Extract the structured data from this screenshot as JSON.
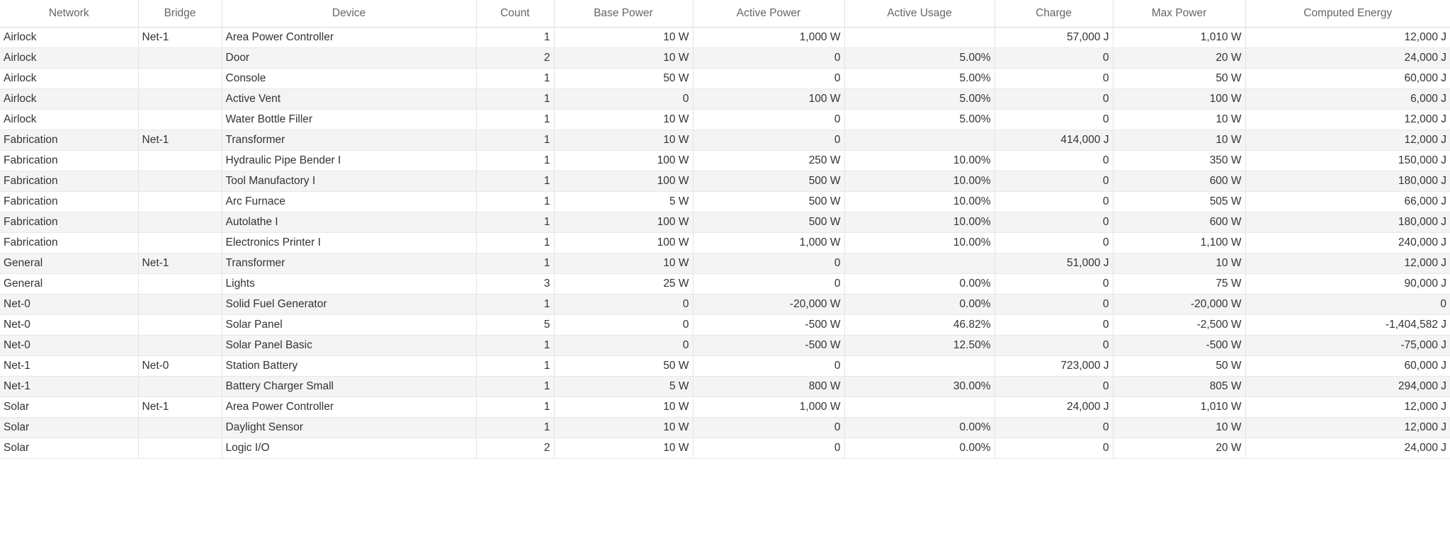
{
  "table": {
    "columns": [
      {
        "key": "network",
        "label": "Network",
        "align": "left"
      },
      {
        "key": "bridge",
        "label": "Bridge",
        "align": "left"
      },
      {
        "key": "device",
        "label": "Device",
        "align": "left"
      },
      {
        "key": "count",
        "label": "Count",
        "align": "right"
      },
      {
        "key": "base_power",
        "label": "Base Power",
        "align": "right"
      },
      {
        "key": "active_power",
        "label": "Active Power",
        "align": "right"
      },
      {
        "key": "active_usage",
        "label": "Active Usage",
        "align": "right"
      },
      {
        "key": "charge",
        "label": "Charge",
        "align": "right"
      },
      {
        "key": "max_power",
        "label": "Max Power",
        "align": "right"
      },
      {
        "key": "computed_energy",
        "label": "Computed Energy",
        "align": "right"
      }
    ],
    "rows": [
      {
        "network": "Airlock",
        "bridge": "Net-1",
        "device": "Area Power Controller",
        "count": "1",
        "base_power": "10 W",
        "active_power": "1,000 W",
        "active_usage": "",
        "charge": "57,000 J",
        "max_power": "1,010 W",
        "computed_energy": "12,000 J"
      },
      {
        "network": "Airlock",
        "bridge": "",
        "device": "Door",
        "count": "2",
        "base_power": "10 W",
        "active_power": "0",
        "active_usage": "5.00%",
        "charge": "0",
        "max_power": "20 W",
        "computed_energy": "24,000 J"
      },
      {
        "network": "Airlock",
        "bridge": "",
        "device": "Console",
        "count": "1",
        "base_power": "50 W",
        "active_power": "0",
        "active_usage": "5.00%",
        "charge": "0",
        "max_power": "50 W",
        "computed_energy": "60,000 J"
      },
      {
        "network": "Airlock",
        "bridge": "",
        "device": "Active Vent",
        "count": "1",
        "base_power": "0",
        "active_power": "100 W",
        "active_usage": "5.00%",
        "charge": "0",
        "max_power": "100 W",
        "computed_energy": "6,000 J"
      },
      {
        "network": "Airlock",
        "bridge": "",
        "device": "Water Bottle Filler",
        "count": "1",
        "base_power": "10 W",
        "active_power": "0",
        "active_usage": "5.00%",
        "charge": "0",
        "max_power": "10 W",
        "computed_energy": "12,000 J"
      },
      {
        "network": "Fabrication",
        "bridge": "Net-1",
        "device": "Transformer",
        "count": "1",
        "base_power": "10 W",
        "active_power": "0",
        "active_usage": "",
        "charge": "414,000 J",
        "max_power": "10 W",
        "computed_energy": "12,000 J"
      },
      {
        "network": "Fabrication",
        "bridge": "",
        "device": "Hydraulic Pipe Bender I",
        "count": "1",
        "base_power": "100 W",
        "active_power": "250 W",
        "active_usage": "10.00%",
        "charge": "0",
        "max_power": "350 W",
        "computed_energy": "150,000 J"
      },
      {
        "network": "Fabrication",
        "bridge": "",
        "device": "Tool Manufactory I",
        "count": "1",
        "base_power": "100 W",
        "active_power": "500 W",
        "active_usage": "10.00%",
        "charge": "0",
        "max_power": "600 W",
        "computed_energy": "180,000 J"
      },
      {
        "network": "Fabrication",
        "bridge": "",
        "device": "Arc Furnace",
        "count": "1",
        "base_power": "5 W",
        "active_power": "500 W",
        "active_usage": "10.00%",
        "charge": "0",
        "max_power": "505 W",
        "computed_energy": "66,000 J"
      },
      {
        "network": "Fabrication",
        "bridge": "",
        "device": "Autolathe I",
        "count": "1",
        "base_power": "100 W",
        "active_power": "500 W",
        "active_usage": "10.00%",
        "charge": "0",
        "max_power": "600 W",
        "computed_energy": "180,000 J"
      },
      {
        "network": "Fabrication",
        "bridge": "",
        "device": "Electronics Printer I",
        "count": "1",
        "base_power": "100 W",
        "active_power": "1,000 W",
        "active_usage": "10.00%",
        "charge": "0",
        "max_power": "1,100 W",
        "computed_energy": "240,000 J"
      },
      {
        "network": "General",
        "bridge": "Net-1",
        "device": "Transformer",
        "count": "1",
        "base_power": "10 W",
        "active_power": "0",
        "active_usage": "",
        "charge": "51,000 J",
        "max_power": "10 W",
        "computed_energy": "12,000 J"
      },
      {
        "network": "General",
        "bridge": "",
        "device": "Lights",
        "count": "3",
        "base_power": "25 W",
        "active_power": "0",
        "active_usage": "0.00%",
        "charge": "0",
        "max_power": "75 W",
        "computed_energy": "90,000 J"
      },
      {
        "network": "Net-0",
        "bridge": "",
        "device": "Solid Fuel Generator",
        "count": "1",
        "base_power": "0",
        "active_power": "-20,000 W",
        "active_usage": "0.00%",
        "charge": "0",
        "max_power": "-20,000 W",
        "computed_energy": "0"
      },
      {
        "network": "Net-0",
        "bridge": "",
        "device": "Solar Panel",
        "count": "5",
        "base_power": "0",
        "active_power": "-500 W",
        "active_usage": "46.82%",
        "charge": "0",
        "max_power": "-2,500 W",
        "computed_energy": "-1,404,582 J"
      },
      {
        "network": "Net-0",
        "bridge": "",
        "device": "Solar Panel Basic",
        "count": "1",
        "base_power": "0",
        "active_power": "-500 W",
        "active_usage": "12.50%",
        "charge": "0",
        "max_power": "-500 W",
        "computed_energy": "-75,000 J"
      },
      {
        "network": "Net-1",
        "bridge": "Net-0",
        "device": "Station Battery",
        "count": "1",
        "base_power": "50 W",
        "active_power": "0",
        "active_usage": "",
        "charge": "723,000 J",
        "max_power": "50 W",
        "computed_energy": "60,000 J"
      },
      {
        "network": "Net-1",
        "bridge": "",
        "device": "Battery Charger Small",
        "count": "1",
        "base_power": "5 W",
        "active_power": "800 W",
        "active_usage": "30.00%",
        "charge": "0",
        "max_power": "805 W",
        "computed_energy": "294,000 J"
      },
      {
        "network": "Solar",
        "bridge": "Net-1",
        "device": "Area Power Controller",
        "count": "1",
        "base_power": "10 W",
        "active_power": "1,000 W",
        "active_usage": "",
        "charge": "24,000 J",
        "max_power": "1,010 W",
        "computed_energy": "12,000 J"
      },
      {
        "network": "Solar",
        "bridge": "",
        "device": "Daylight Sensor",
        "count": "1",
        "base_power": "10 W",
        "active_power": "0",
        "active_usage": "0.00%",
        "charge": "0",
        "max_power": "10 W",
        "computed_energy": "12,000 J"
      },
      {
        "network": "Solar",
        "bridge": "",
        "device": "Logic I/O",
        "count": "2",
        "base_power": "10 W",
        "active_power": "0",
        "active_usage": "0.00%",
        "charge": "0",
        "max_power": "20 W",
        "computed_energy": "24,000 J"
      }
    ]
  }
}
